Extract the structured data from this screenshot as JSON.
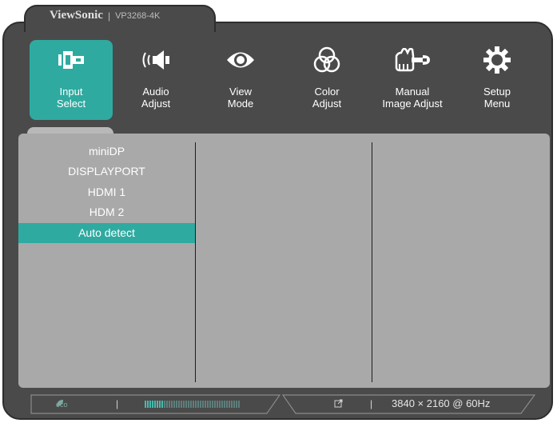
{
  "header": {
    "brand": "ViewSonic",
    "separator": "|",
    "model": "VP3268-4K"
  },
  "menu": [
    {
      "label": "Input\nSelect",
      "icon": "input-select-icon",
      "active": true
    },
    {
      "label": "Audio\nAdjust",
      "icon": "speaker-icon",
      "active": false
    },
    {
      "label": "View\nMode",
      "icon": "eye-icon",
      "active": false
    },
    {
      "label": "Color\nAdjust",
      "icon": "color-circles-icon",
      "active": false
    },
    {
      "label": "Manual\nImage Adjust",
      "icon": "hand-wrench-icon",
      "active": false
    },
    {
      "label": "Setup\nMenu",
      "icon": "gear-icon",
      "active": false
    }
  ],
  "input_list": {
    "items": [
      "miniDP",
      "DISPLAYPORT",
      "HDMI 1",
      "HDM 2",
      "Auto detect"
    ],
    "selected": "Auto detect"
  },
  "status_bar": {
    "eco_label": "eco",
    "separator": "|",
    "resolution": "3840 × 2160 @ 60Hz"
  },
  "colors": {
    "accent": "#2faaa0",
    "frame": "#4a4a4a",
    "panel": "#a9a9a9"
  }
}
